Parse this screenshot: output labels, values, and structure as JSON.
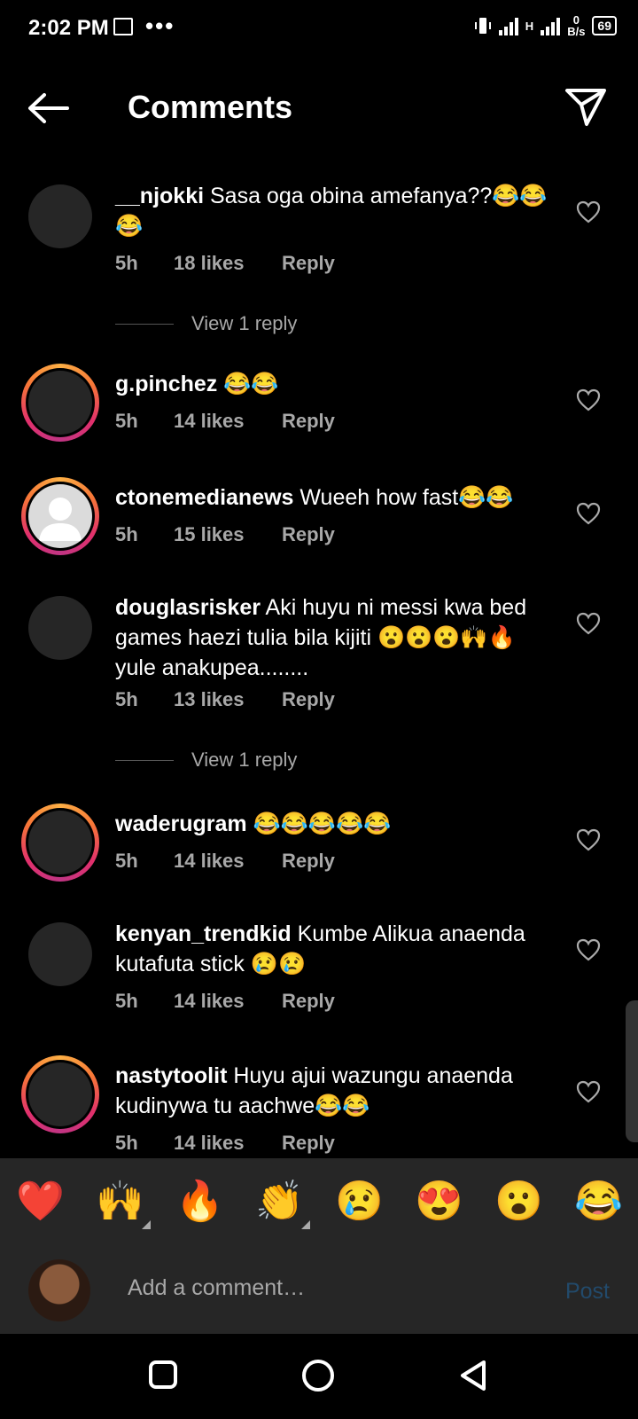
{
  "status": {
    "time": "2:02 PM",
    "dots": "•••",
    "speed_value": "0",
    "speed_unit": "B/s",
    "network": "H",
    "battery": "69"
  },
  "header": {
    "title": "Comments"
  },
  "comments": [
    {
      "user": "__njokki",
      "text": " Sasa oga obina amefanya??😂😂😂",
      "time": "5h",
      "likes": "18 likes",
      "reply": "Reply",
      "view_replies": "View 1 reply"
    },
    {
      "user": "g.pinchez",
      "text": " 😂😂",
      "time": "5h",
      "likes": "14 likes",
      "reply": "Reply"
    },
    {
      "user": "ctonemedianews",
      "text": " Wueeh how fast😂😂",
      "time": "5h",
      "likes": "15 likes",
      "reply": "Reply"
    },
    {
      "user": "douglasrisker",
      "text": " Aki huyu ni messi kwa bed games haezi tulia bila kijiti 😮😮😮🙌🔥yule anakupea........",
      "time": "5h",
      "likes": "13 likes",
      "reply": "Reply",
      "view_replies": "View 1 reply"
    },
    {
      "user": "waderugram",
      "text": " 😂😂😂😂😂",
      "time": "5h",
      "likes": "14 likes",
      "reply": "Reply"
    },
    {
      "user": "kenyan_trendkid",
      "text": " Kumbe Alikua anaenda kutafuta stick 😢😢",
      "time": "5h",
      "likes": "14 likes",
      "reply": "Reply"
    },
    {
      "user": "nastytoolit",
      "text": " Huyu ajui wazungu anaenda kudinywa tu aachwe😂😂",
      "time": "5h",
      "likes": "14 likes",
      "reply": "Reply"
    }
  ],
  "emoji_bar": [
    "❤️",
    "🙌",
    "🔥",
    "👏",
    "😢",
    "😍",
    "😮",
    "😂"
  ],
  "compose": {
    "placeholder": "Add a comment…",
    "post": "Post"
  },
  "colors": {
    "background": "#000000",
    "muted_text": "#a8a8a8",
    "bar_bg": "#262626",
    "post_disabled": "#224a6b"
  }
}
